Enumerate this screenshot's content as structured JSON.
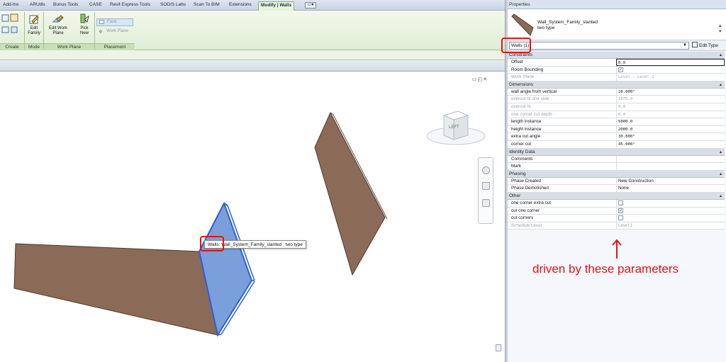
{
  "ribbon": {
    "tabs": [
      "Add-Ins",
      "ARUtils",
      "Bonus Tools",
      "CASE",
      "Revit Express Tools",
      "SODIS Labs",
      "Scan To BIM",
      "Extensions",
      "Modify | Walls"
    ],
    "active_tab": "Modify | Walls",
    "buttons": {
      "edit_family": "Edit Family",
      "edit_work_plane": "Edit Work Plane",
      "pick_new": "Pick New",
      "face": "Face",
      "work_plane": "Work Plane"
    },
    "panels": {
      "create": "Create",
      "mode": "Mode",
      "work_plane": "Work Plane",
      "placement": "Placement"
    }
  },
  "viewport": {
    "viewcube_label": "LEFT",
    "tooltip_prefix": "Walls",
    "tooltip_rest": ": Wall_System_Family_slanted : two type",
    "colors": {
      "wall_brown": "#8b6a58",
      "selected_blue": "#7a9fdb",
      "selected_edge": "#2e5fd0"
    }
  },
  "properties": {
    "title": "Properties",
    "type_name_line1": "Wall_System_Family_slanted",
    "type_name_line2": "two type",
    "instance_selector": "Walls (1)",
    "edit_type": "Edit Type",
    "groups": {
      "constraints": "Constraints",
      "dimensions": "Dimensions",
      "identity": "Identity Data",
      "phasing": "Phasing",
      "other": "Other"
    },
    "rows": {
      "offset": {
        "name": "Offset",
        "value": "0.0"
      },
      "room_bounding": {
        "name": "Room Bounding",
        "checked": true
      },
      "work_plane": {
        "name": "Work Plane",
        "value": "Level : Level 1"
      },
      "wall_angle": {
        "name": "wall angle from vertical",
        "value": "20.000°"
      },
      "overcut_one_side": {
        "name": "overcut ht one side",
        "value": "1075.4"
      },
      "overcut_ht": {
        "name": "overcut ht",
        "value": "0.0"
      },
      "one_corner_cut_depth": {
        "name": "one corner cut depth",
        "value": "0.0"
      },
      "length_instance": {
        "name": "length instance",
        "value": "5000.0"
      },
      "height_instance": {
        "name": "height instance",
        "value": "2000.0"
      },
      "extra_cut_angle": {
        "name": "extra cut angle",
        "value": "30.000°"
      },
      "corner_cut": {
        "name": "corner cut",
        "value": "45.000°"
      },
      "comments": {
        "name": "Comments",
        "value": ""
      },
      "mark": {
        "name": "Mark",
        "value": ""
      },
      "phase_created": {
        "name": "Phase Created",
        "value": "New Construction"
      },
      "phase_demolished": {
        "name": "Phase Demolished",
        "value": "None"
      },
      "one_corner_extra_cut": {
        "name": "one corner extra cut",
        "checked": false
      },
      "cut_one_corner": {
        "name": "cut one corner",
        "checked": true
      },
      "cut_corners": {
        "name": "cut corners",
        "checked": false
      },
      "schedule_level": {
        "name": "Schedule Level",
        "value": "Level 1"
      }
    }
  },
  "annotation": {
    "text": "driven by these parameters",
    "color": "#e11414"
  }
}
